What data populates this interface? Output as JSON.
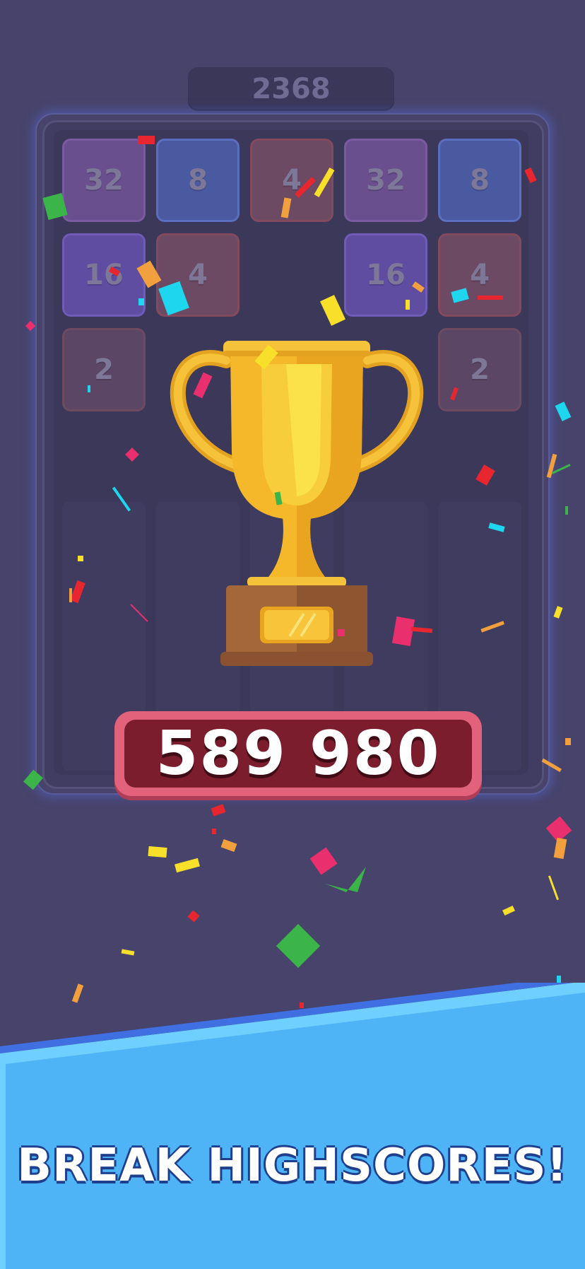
{
  "header": {
    "best_score": "2368"
  },
  "board": {
    "tiles": [
      {
        "value": "32",
        "color": "#6a4f8e"
      },
      {
        "value": "8",
        "color": "#4a5aa0"
      },
      {
        "value": "4",
        "color": "#6d4a63"
      },
      {
        "value": "32",
        "color": "#6a4f8e"
      },
      {
        "value": "8",
        "color": "#4a5aa0"
      },
      {
        "value": "16",
        "color": "#5e4da0"
      },
      {
        "value": "4",
        "color": "#6d4a63"
      },
      {
        "value": "16",
        "color": "#5e4da0"
      },
      {
        "value": "4",
        "color": "#6d4a63"
      },
      {
        "value": "2",
        "color": "#5c4666"
      },
      {
        "value": "2",
        "color": "#5c4666"
      }
    ]
  },
  "trophy": {
    "icon": "trophy-icon",
    "color": "#f5b82a"
  },
  "score": {
    "value": "589 980"
  },
  "promo": {
    "slogan": "BREAK HIGHSCORES!"
  },
  "colors": {
    "background": "#47436b",
    "score_banner": "#7c1d2e",
    "score_banner_border": "#e3627b",
    "panel_blue": "#4fb4f5"
  }
}
